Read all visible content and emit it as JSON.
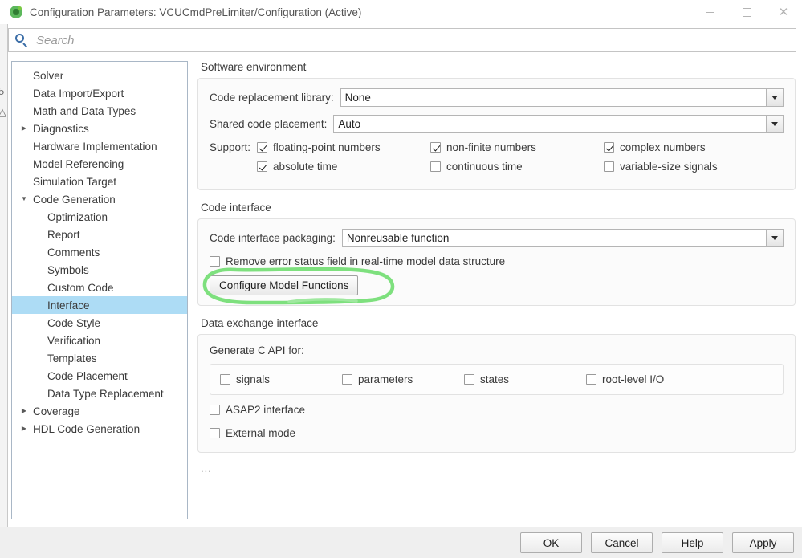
{
  "window": {
    "title": "Configuration Parameters: VCUCmdPreLimiter/Configuration (Active)",
    "icon": "simulink-icon",
    "minimize_label": "–",
    "maximize_label": "□",
    "close_label": "✕"
  },
  "search": {
    "placeholder": "Search",
    "value": "",
    "icon": "search-icon"
  },
  "sidebar": {
    "items": [
      {
        "label": "Solver",
        "level": 0,
        "twisty": "",
        "selected": false
      },
      {
        "label": "Data Import/Export",
        "level": 0,
        "twisty": "",
        "selected": false
      },
      {
        "label": "Math and Data Types",
        "level": 0,
        "twisty": "",
        "selected": false
      },
      {
        "label": "Diagnostics",
        "level": 0,
        "twisty": "▶",
        "selected": false
      },
      {
        "label": "Hardware Implementation",
        "level": 0,
        "twisty": "",
        "selected": false
      },
      {
        "label": "Model Referencing",
        "level": 0,
        "twisty": "",
        "selected": false
      },
      {
        "label": "Simulation Target",
        "level": 0,
        "twisty": "",
        "selected": false
      },
      {
        "label": "Code Generation",
        "level": 0,
        "twisty": "▼",
        "selected": false
      },
      {
        "label": "Optimization",
        "level": 1,
        "twisty": "",
        "selected": false
      },
      {
        "label": "Report",
        "level": 1,
        "twisty": "",
        "selected": false
      },
      {
        "label": "Comments",
        "level": 1,
        "twisty": "",
        "selected": false
      },
      {
        "label": "Symbols",
        "level": 1,
        "twisty": "",
        "selected": false
      },
      {
        "label": "Custom Code",
        "level": 1,
        "twisty": "",
        "selected": false
      },
      {
        "label": "Interface",
        "level": 1,
        "twisty": "",
        "selected": true
      },
      {
        "label": "Code Style",
        "level": 1,
        "twisty": "",
        "selected": false
      },
      {
        "label": "Verification",
        "level": 1,
        "twisty": "",
        "selected": false
      },
      {
        "label": "Templates",
        "level": 1,
        "twisty": "",
        "selected": false
      },
      {
        "label": "Code Placement",
        "level": 1,
        "twisty": "",
        "selected": false
      },
      {
        "label": "Data Type Replacement",
        "level": 1,
        "twisty": "",
        "selected": false
      },
      {
        "label": "Coverage",
        "level": 0,
        "twisty": "▶",
        "selected": false
      },
      {
        "label": "HDL Code Generation",
        "level": 0,
        "twisty": "▶",
        "selected": false
      }
    ]
  },
  "software_environment": {
    "title": "Software environment",
    "code_replacement_library": {
      "label": "Code replacement library:",
      "value": "None"
    },
    "shared_code_placement": {
      "label": "Shared code placement:",
      "value": "Auto"
    },
    "support_prefix": "Support:",
    "support_row1": [
      {
        "label": "floating-point numbers",
        "checked": true
      },
      {
        "label": "non-finite numbers",
        "checked": true
      },
      {
        "label": "complex numbers",
        "checked": true
      }
    ],
    "support_row2": [
      {
        "label": "absolute time",
        "checked": true
      },
      {
        "label": "continuous time",
        "checked": false
      },
      {
        "label": "variable-size signals",
        "checked": false
      }
    ]
  },
  "code_interface": {
    "title": "Code interface",
    "packaging": {
      "label": "Code interface packaging:",
      "value": "Nonreusable function"
    },
    "remove_error_status": {
      "label": "Remove error status field in real-time model data structure",
      "checked": false
    },
    "configure_button": "Configure Model Functions",
    "annotation_color": "#7ee07e"
  },
  "data_exchange": {
    "title": "Data exchange interface",
    "generate_c_api_label": "Generate C API for:",
    "c_api_items": [
      {
        "label": "signals",
        "checked": false
      },
      {
        "label": "parameters",
        "checked": false
      },
      {
        "label": "states",
        "checked": false
      },
      {
        "label": "root-level I/O",
        "checked": false
      }
    ],
    "asap2": {
      "label": "ASAP2 interface",
      "checked": false
    },
    "external_mode": {
      "label": "External mode",
      "checked": false
    },
    "ellipsis": "..."
  },
  "footer": {
    "ok": "OK",
    "cancel": "Cancel",
    "help": "Help",
    "apply": "Apply"
  },
  "background": {
    "mark1": "5",
    "mark2": "△"
  }
}
